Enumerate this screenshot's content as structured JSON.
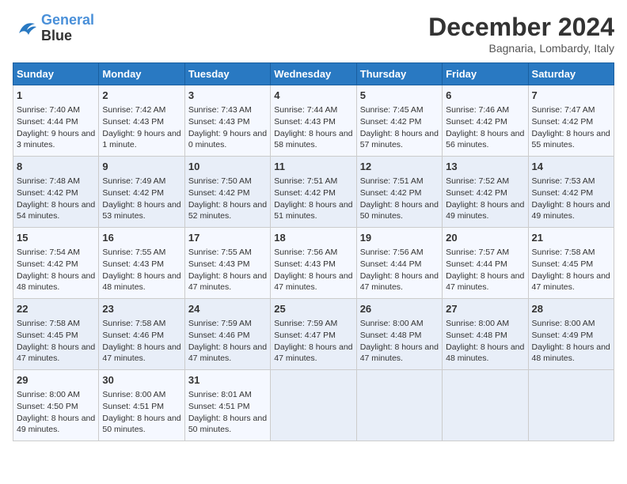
{
  "logo": {
    "line1": "General",
    "line2": "Blue"
  },
  "title": "December 2024",
  "subtitle": "Bagnaria, Lombardy, Italy",
  "headers": [
    "Sunday",
    "Monday",
    "Tuesday",
    "Wednesday",
    "Thursday",
    "Friday",
    "Saturday"
  ],
  "weeks": [
    [
      {
        "day": "1",
        "rise": "7:40 AM",
        "set": "4:44 PM",
        "daylight": "9 hours and 3 minutes."
      },
      {
        "day": "2",
        "rise": "7:42 AM",
        "set": "4:43 PM",
        "daylight": "9 hours and 1 minute."
      },
      {
        "day": "3",
        "rise": "7:43 AM",
        "set": "4:43 PM",
        "daylight": "9 hours and 0 minutes."
      },
      {
        "day": "4",
        "rise": "7:44 AM",
        "set": "4:43 PM",
        "daylight": "8 hours and 58 minutes."
      },
      {
        "day": "5",
        "rise": "7:45 AM",
        "set": "4:42 PM",
        "daylight": "8 hours and 57 minutes."
      },
      {
        "day": "6",
        "rise": "7:46 AM",
        "set": "4:42 PM",
        "daylight": "8 hours and 56 minutes."
      },
      {
        "day": "7",
        "rise": "7:47 AM",
        "set": "4:42 PM",
        "daylight": "8 hours and 55 minutes."
      }
    ],
    [
      {
        "day": "8",
        "rise": "7:48 AM",
        "set": "4:42 PM",
        "daylight": "8 hours and 54 minutes."
      },
      {
        "day": "9",
        "rise": "7:49 AM",
        "set": "4:42 PM",
        "daylight": "8 hours and 53 minutes."
      },
      {
        "day": "10",
        "rise": "7:50 AM",
        "set": "4:42 PM",
        "daylight": "8 hours and 52 minutes."
      },
      {
        "day": "11",
        "rise": "7:51 AM",
        "set": "4:42 PM",
        "daylight": "8 hours and 51 minutes."
      },
      {
        "day": "12",
        "rise": "7:51 AM",
        "set": "4:42 PM",
        "daylight": "8 hours and 50 minutes."
      },
      {
        "day": "13",
        "rise": "7:52 AM",
        "set": "4:42 PM",
        "daylight": "8 hours and 49 minutes."
      },
      {
        "day": "14",
        "rise": "7:53 AM",
        "set": "4:42 PM",
        "daylight": "8 hours and 49 minutes."
      }
    ],
    [
      {
        "day": "15",
        "rise": "7:54 AM",
        "set": "4:42 PM",
        "daylight": "8 hours and 48 minutes."
      },
      {
        "day": "16",
        "rise": "7:55 AM",
        "set": "4:43 PM",
        "daylight": "8 hours and 48 minutes."
      },
      {
        "day": "17",
        "rise": "7:55 AM",
        "set": "4:43 PM",
        "daylight": "8 hours and 47 minutes."
      },
      {
        "day": "18",
        "rise": "7:56 AM",
        "set": "4:43 PM",
        "daylight": "8 hours and 47 minutes."
      },
      {
        "day": "19",
        "rise": "7:56 AM",
        "set": "4:44 PM",
        "daylight": "8 hours and 47 minutes."
      },
      {
        "day": "20",
        "rise": "7:57 AM",
        "set": "4:44 PM",
        "daylight": "8 hours and 47 minutes."
      },
      {
        "day": "21",
        "rise": "7:58 AM",
        "set": "4:45 PM",
        "daylight": "8 hours and 47 minutes."
      }
    ],
    [
      {
        "day": "22",
        "rise": "7:58 AM",
        "set": "4:45 PM",
        "daylight": "8 hours and 47 minutes."
      },
      {
        "day": "23",
        "rise": "7:58 AM",
        "set": "4:46 PM",
        "daylight": "8 hours and 47 minutes."
      },
      {
        "day": "24",
        "rise": "7:59 AM",
        "set": "4:46 PM",
        "daylight": "8 hours and 47 minutes."
      },
      {
        "day": "25",
        "rise": "7:59 AM",
        "set": "4:47 PM",
        "daylight": "8 hours and 47 minutes."
      },
      {
        "day": "26",
        "rise": "8:00 AM",
        "set": "4:48 PM",
        "daylight": "8 hours and 47 minutes."
      },
      {
        "day": "27",
        "rise": "8:00 AM",
        "set": "4:48 PM",
        "daylight": "8 hours and 48 minutes."
      },
      {
        "day": "28",
        "rise": "8:00 AM",
        "set": "4:49 PM",
        "daylight": "8 hours and 48 minutes."
      }
    ],
    [
      {
        "day": "29",
        "rise": "8:00 AM",
        "set": "4:50 PM",
        "daylight": "8 hours and 49 minutes."
      },
      {
        "day": "30",
        "rise": "8:00 AM",
        "set": "4:51 PM",
        "daylight": "8 hours and 50 minutes."
      },
      {
        "day": "31",
        "rise": "8:01 AM",
        "set": "4:51 PM",
        "daylight": "8 hours and 50 minutes."
      },
      null,
      null,
      null,
      null
    ]
  ]
}
